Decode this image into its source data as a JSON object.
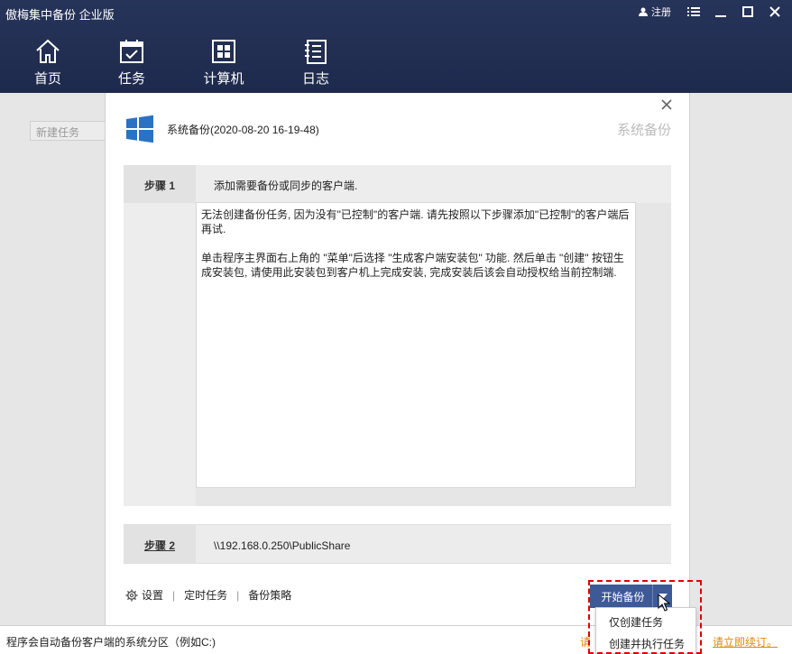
{
  "app": {
    "title": "傲梅集中备份 企业版",
    "register_label": "注册"
  },
  "nav": {
    "items": [
      {
        "label": "首页",
        "icon": "home-icon"
      },
      {
        "label": "任务",
        "icon": "task-icon"
      },
      {
        "label": "计算机",
        "icon": "computer-icon"
      },
      {
        "label": "日志",
        "icon": "log-icon"
      }
    ]
  },
  "background": {
    "new_task_placeholder": "新建任务"
  },
  "dialog": {
    "title": "系统备份(2020-08-20 16-19-48)",
    "watermark": "系统备份",
    "step1": {
      "label": "步骤 1",
      "description": "添加需要备份或同步的客户端.",
      "message_p1": "无法创建备份任务, 因为没有\"已控制\"的客户端. 请先按照以下步骤添加\"已控制\"的客户端后再试.",
      "message_p2": "单击程序主界面右上角的 \"菜单\"后选择 \"生成客户端安装包\" 功能. 然后单击 \"创建\" 按钮生成安装包, 请使用此安装包到客户机上完成安装, 完成安装后该会自动授权给当前控制端."
    },
    "step2": {
      "label": "步骤 2",
      "value": "\\\\192.168.0.250\\PublicShare"
    },
    "footer": {
      "settings": "设置",
      "schedule": "定时任务",
      "strategy": "备份策略"
    },
    "start_button": "开始备份",
    "dropdown_options": [
      "仅创建任务",
      "创建并执行任务"
    ]
  },
  "statusbar": {
    "text": "程序会自动备份客户端的系统分区（例如C:)",
    "link_left": "请",
    "link_right": "请立即续订。"
  },
  "colors": {
    "header_bg": "#1e2a4c",
    "button_bg": "#3d5a96",
    "highlight": "#e00000",
    "link": "#e08a00"
  }
}
